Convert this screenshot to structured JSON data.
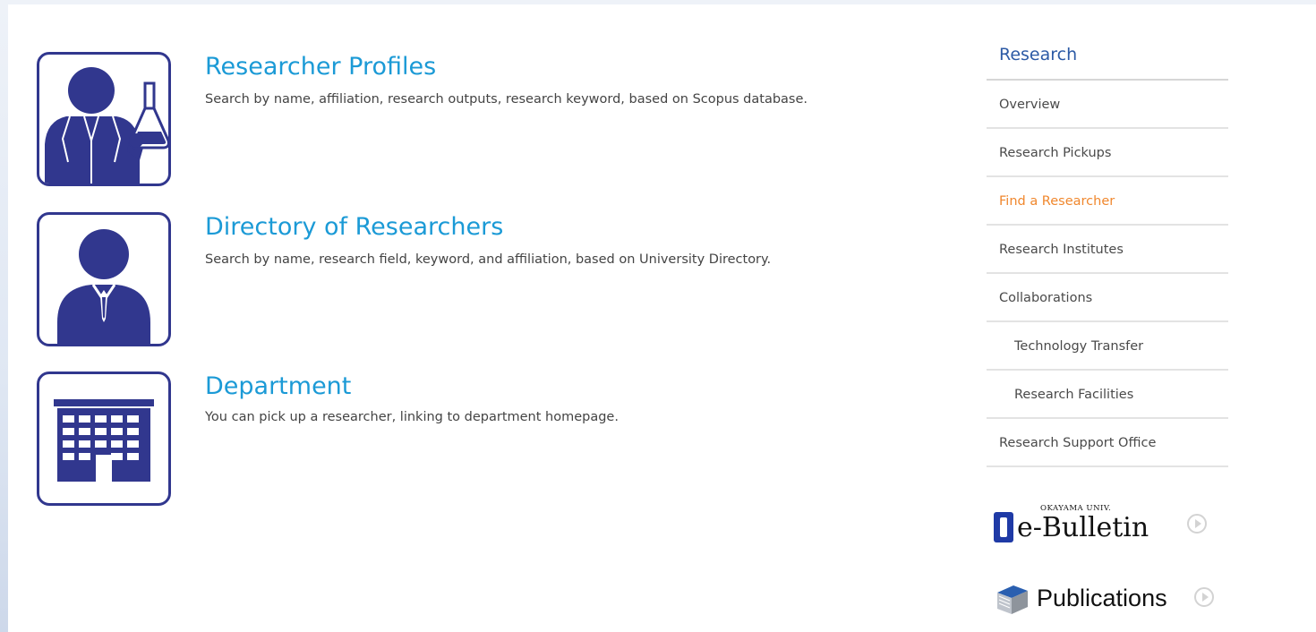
{
  "entries": [
    {
      "title": "Researcher Profiles",
      "description": "Search by name, affiliation, research outputs, research keyword, based on Scopus database.",
      "icon": "scientist-icon"
    },
    {
      "title": "Directory of Researchers",
      "description": "Search by name, research field, keyword, and affiliation, based on University Directory.",
      "icon": "person-icon"
    },
    {
      "title": "Department",
      "description": "You can pick up a researcher, linking to department homepage.",
      "icon": "building-icon"
    }
  ],
  "sidebar": {
    "heading": "Research",
    "items": [
      {
        "label": "Overview",
        "active": false,
        "sub": false
      },
      {
        "label": "Research Pickups",
        "active": false,
        "sub": false
      },
      {
        "label": "Find a Researcher",
        "active": true,
        "sub": false
      },
      {
        "label": "Research Institutes",
        "active": false,
        "sub": false
      },
      {
        "label": "Collaborations",
        "active": false,
        "sub": false
      },
      {
        "label": "Technology Transfer",
        "active": false,
        "sub": true
      },
      {
        "label": "Research Facilities",
        "active": false,
        "sub": true
      },
      {
        "label": "Research Support Office",
        "active": false,
        "sub": false
      }
    ]
  },
  "banners": {
    "ebulletin": {
      "small_label": "OKAYAMA UNIV.",
      "label": "e-Bulletin"
    },
    "publications": {
      "label": "Publications"
    }
  },
  "colors": {
    "icon_blue": "#31378e",
    "title_blue": "#1b9ad6",
    "heading_blue": "#2c5aa5",
    "active_orange": "#f0872d"
  }
}
